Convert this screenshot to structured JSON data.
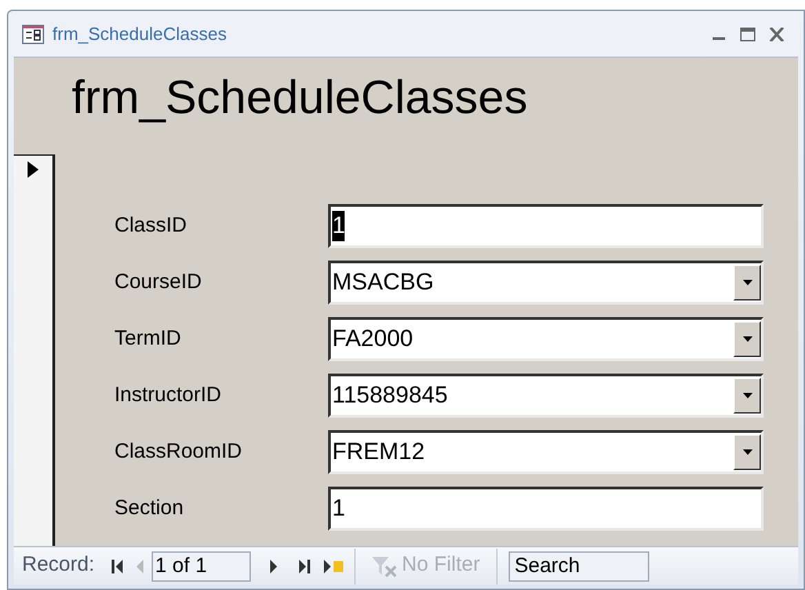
{
  "window": {
    "title": "frm_ScheduleClasses"
  },
  "form_title": "frm_ScheduleClasses",
  "record_selector": {
    "current": true
  },
  "fields": [
    {
      "label": "ClassID",
      "value": "1",
      "kind": "text",
      "selected": true
    },
    {
      "label": "CourseID",
      "value": "MSACBG",
      "kind": "combo",
      "selected": false
    },
    {
      "label": "TermID",
      "value": "FA2000",
      "kind": "combo",
      "selected": false
    },
    {
      "label": "InstructorID",
      "value": "115889845",
      "kind": "combo",
      "selected": false
    },
    {
      "label": "ClassRoomID",
      "value": "FREM12",
      "kind": "combo",
      "selected": false
    },
    {
      "label": "Section",
      "value": "1",
      "kind": "text",
      "selected": false
    }
  ],
  "navigation": {
    "label": "Record:",
    "position": "1 of 1",
    "filter": "No Filter",
    "search": "Search"
  }
}
